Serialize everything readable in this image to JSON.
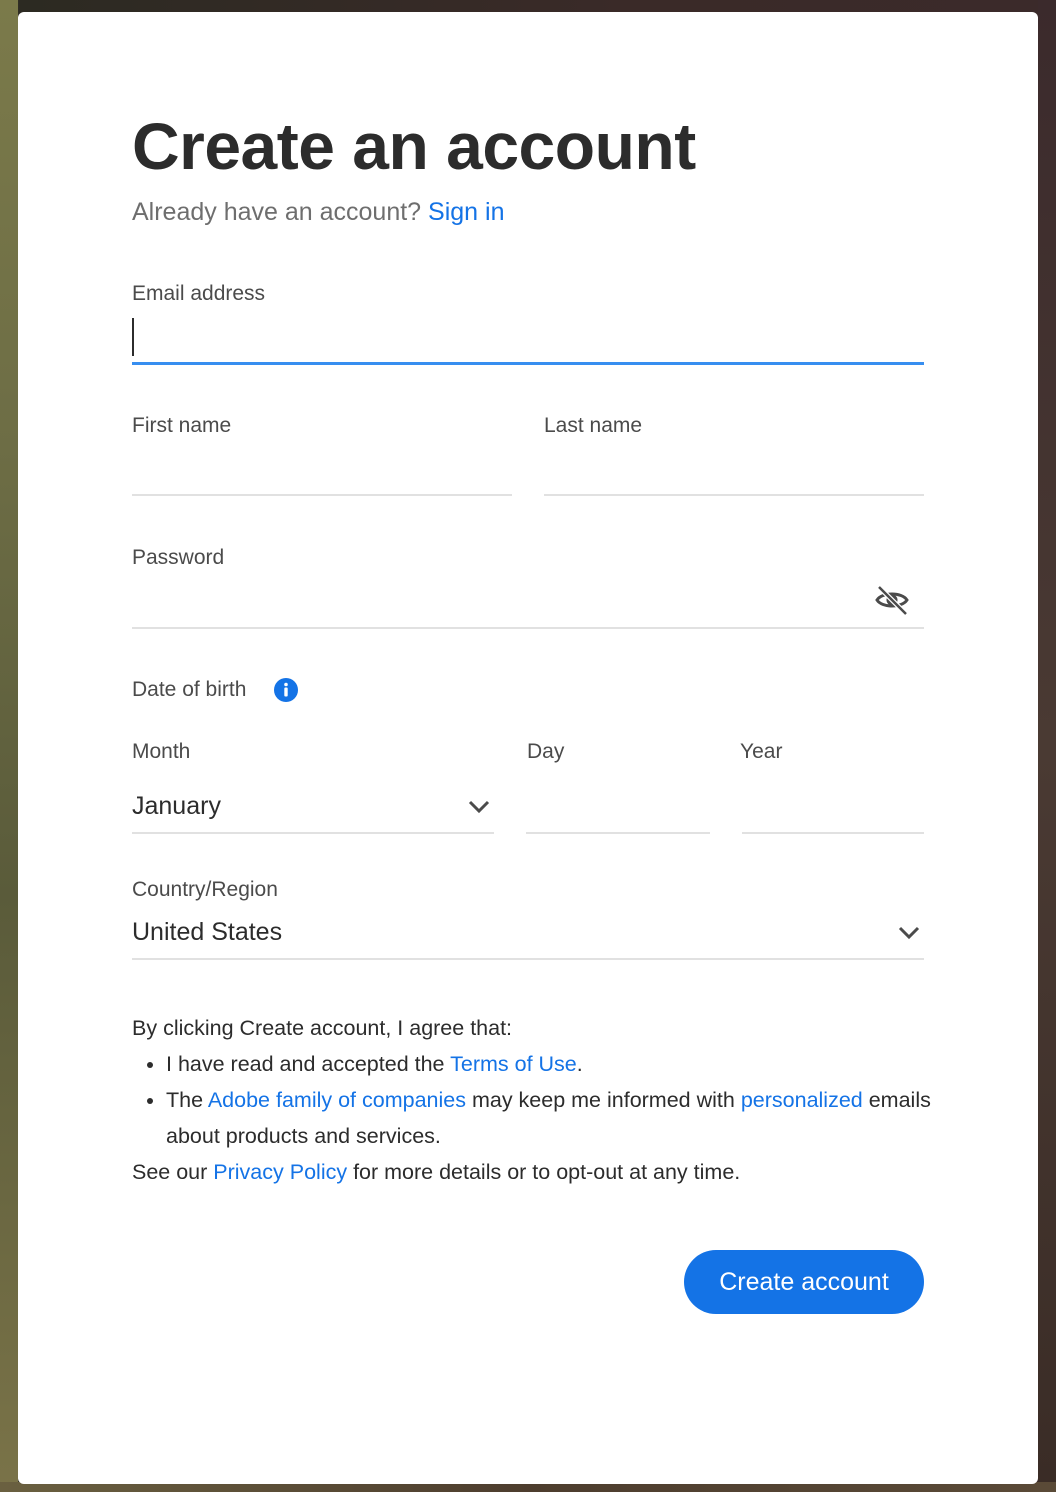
{
  "header": {
    "title": "Create an account",
    "signin_prompt": "Already have an account?",
    "signin_link": "Sign in"
  },
  "form": {
    "email": {
      "label": "Email address",
      "value": ""
    },
    "first_name": {
      "label": "First name",
      "value": ""
    },
    "last_name": {
      "label": "Last name",
      "value": ""
    },
    "password": {
      "label": "Password",
      "value": "",
      "toggle_icon": "eye-off-icon"
    },
    "dob": {
      "label": "Date of birth",
      "info_icon": "info-icon",
      "month": {
        "label": "Month",
        "value": "January"
      },
      "day": {
        "label": "Day",
        "value": ""
      },
      "year": {
        "label": "Year",
        "value": ""
      }
    },
    "country": {
      "label": "Country/Region",
      "value": "United States"
    }
  },
  "legal": {
    "intro": "By clicking Create account, I agree that:",
    "item1_pre": "I have read and accepted the ",
    "item1_link": "Terms of Use",
    "item1_post": ".",
    "item2_pre": "The ",
    "item2_link1": "Adobe family of companies",
    "item2_mid": " may keep me informed with ",
    "item2_link2": "personalized",
    "item2_post": " emails about products and services.",
    "footer_pre": "See our ",
    "footer_link": "Privacy Policy",
    "footer_post": " for more details or to opt-out at any time."
  },
  "actions": {
    "create_label": "Create account"
  },
  "colors": {
    "accent": "#1473e6",
    "focus": "#378ef0",
    "text": "#2c2c2c"
  }
}
